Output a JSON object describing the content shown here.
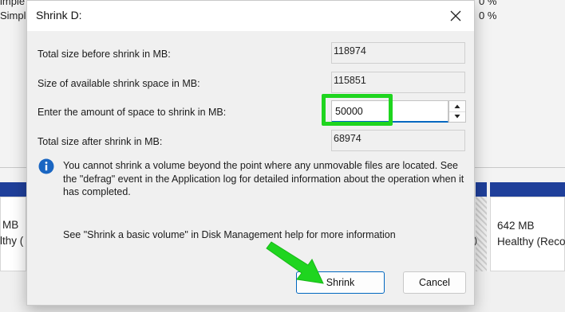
{
  "background": {
    "list_rows": [
      {
        "text": "imple",
        "pct": "0 %"
      },
      {
        "text": "Simpl",
        "pct": "0 %"
      }
    ],
    "cards": [
      {
        "size": "MB",
        "status": "lthy ("
      },
      {
        "size": "642 MB",
        "status": "Healthy (Reco"
      }
    ],
    "right_fragment": ")",
    "strip_color": "#1f3f9a"
  },
  "dialog": {
    "title": "Shrink D:",
    "close_icon": "close-icon",
    "rows": {
      "total_before": {
        "label": "Total size before shrink in MB:",
        "value": "118974"
      },
      "available": {
        "label": "Size of available shrink space in MB:",
        "value": "115851"
      },
      "amount": {
        "label": "Enter the amount of space to shrink in MB:",
        "value": "50000"
      },
      "total_after": {
        "label": "Total size after shrink in MB:",
        "value": "68974"
      }
    },
    "info_icon": "info-icon",
    "info_text": "You cannot shrink a volume beyond the point where any unmovable files are located. See the \"defrag\" event in the Application log for detailed information about the operation when it has completed.",
    "help_text": "See \"Shrink a basic volume\" in Disk Management help for more information",
    "buttons": {
      "shrink": "Shrink",
      "cancel": "Cancel"
    }
  },
  "annotations": {
    "highlight_color": "#1fd51f",
    "arrow_color": "#1fd51f"
  }
}
